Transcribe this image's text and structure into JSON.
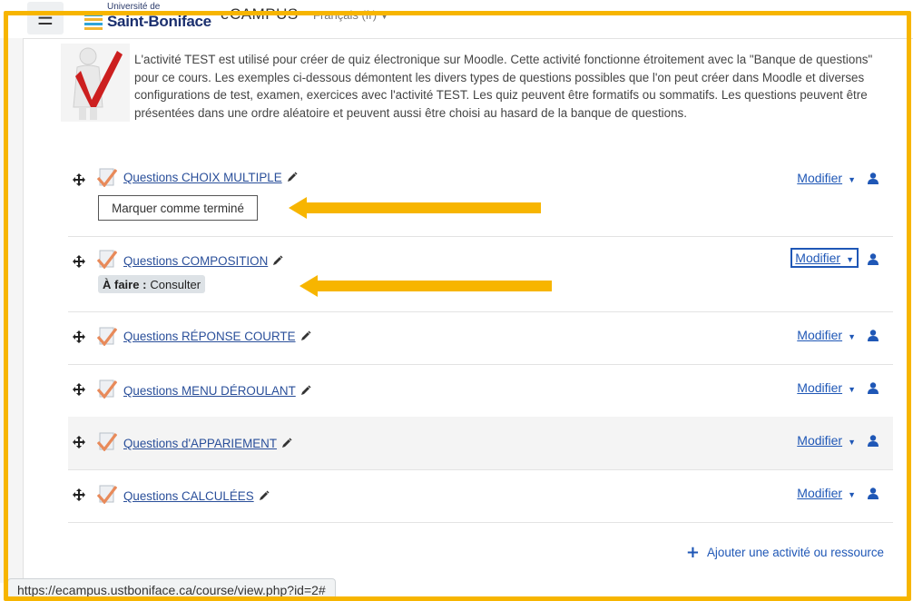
{
  "navbar": {
    "menu_icon": "hamburger-icon",
    "logo_small": "Université de",
    "logo_big": "Saint-Boniface",
    "site_name": "eCAMPUS",
    "language": "Français (fr)"
  },
  "description": "L'activité TEST est utilisé pour créer de quiz électronique sur Moodle. Cette activité fonctionne étroitement avec la \"Banque de questions\" pour ce cours. Les exemples ci-dessous démontent les divers types de questions possibles que l'on peut créer dans Moodle et diverses configurations de test, examen, exercices avec l'activité TEST. Les quiz peuvent être formatifs ou sommatifs. Les questions peuvent être présentées dans une ordre aléatoire et peuvent aussi être choisi au hasard de la banque de questions.",
  "activities": [
    {
      "title": "Questions CHOIX MULTIPLE",
      "modifier": "Modifier"
    },
    {
      "title": "Questions COMPOSITION",
      "modifier": "Modifier"
    },
    {
      "title": "Questions RÉPONSE COURTE",
      "modifier": "Modifier"
    },
    {
      "title": "Questions MENU DÉROULANT",
      "modifier": "Modifier"
    },
    {
      "title": "Questions d'APPARIEMENT",
      "modifier": "Modifier"
    },
    {
      "title": "Questions CALCULÉES",
      "modifier": "Modifier"
    }
  ],
  "mark_done_label": "Marquer comme terminé",
  "todo": {
    "label": "À faire :",
    "value": "Consulter"
  },
  "add_activity_label": "Ajouter une activité ou ressource",
  "status_url": "https://ecampus.ustboniface.ca/course/view.php?id=2#",
  "colors": {
    "highlight": "#f7b500",
    "link": "#1f57b6"
  }
}
